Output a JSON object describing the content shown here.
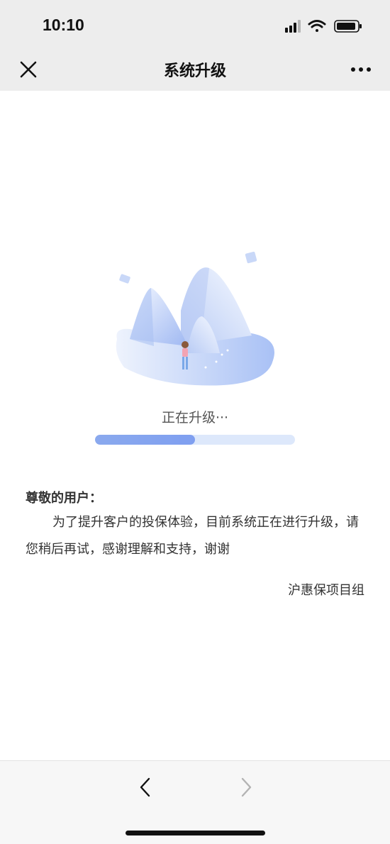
{
  "status_bar": {
    "time": "10:10",
    "icons": [
      "signal-icon",
      "wifi-icon",
      "battery-icon"
    ]
  },
  "nav": {
    "title": "系统升级",
    "close_icon": "close-icon",
    "more_icon": "more-icon"
  },
  "main": {
    "status_text": "正在升级···",
    "progress": 0.5,
    "greeting": "尊敬的用户：",
    "message": "为了提升客户的投保体验，目前系统正在进行升级，请您稍后再试，感谢理解和支持，谢谢",
    "signature": "沪惠保项目组"
  },
  "bottom_nav": {
    "back_icon": "chevron-left-icon",
    "forward_icon": "chevron-right-icon"
  },
  "colors": {
    "accent": "#8aa9ee",
    "track": "#dde8fb",
    "bar_bg": "#ededed"
  }
}
